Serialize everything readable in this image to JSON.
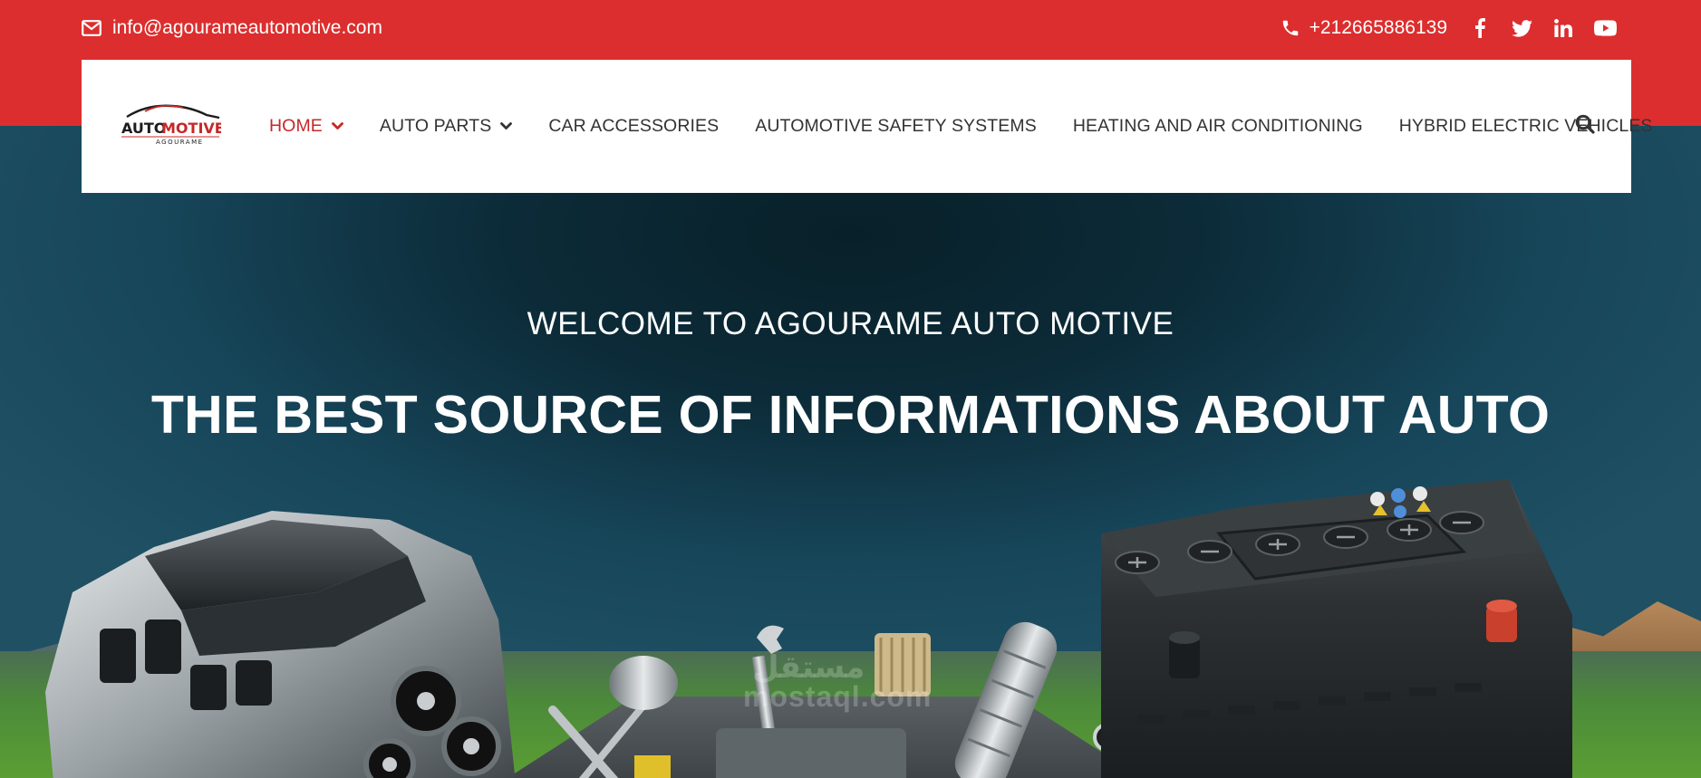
{
  "topbar": {
    "email": "info@agourameautomotive.com",
    "phone": "+212665886139",
    "socials": [
      {
        "icon": "facebook-icon"
      },
      {
        "icon": "twitter-icon"
      },
      {
        "icon": "linkedin-icon"
      },
      {
        "icon": "youtube-icon"
      }
    ],
    "bg_color": "#dc2e2e"
  },
  "logo": {
    "line1a": "AUTO",
    "line1b": "MOTIVE",
    "line2": "AGOURAME"
  },
  "nav": {
    "items": [
      {
        "label": "HOME",
        "dropdown": true,
        "active": true
      },
      {
        "label": "AUTO PARTS",
        "dropdown": true,
        "active": false
      },
      {
        "label": "CAR ACCESSORIES",
        "dropdown": false,
        "active": false
      },
      {
        "label": "AUTOMOTIVE SAFETY SYSTEMS",
        "dropdown": false,
        "active": false
      },
      {
        "label": "HEATING AND AIR CONDITIONING",
        "dropdown": false,
        "active": false
      },
      {
        "label": "HYBRID ELECTRIC VEHICLES",
        "dropdown": false,
        "active": false
      }
    ],
    "active_color": "#c62828"
  },
  "hero": {
    "welcome": "WELCOME TO AGOURAME AUTO MOTIVE",
    "headline": "THE BEST SOURCE OF INFORMATIONS ABOUT AUTO",
    "watermark": "mostaql.com",
    "watermark_ar": "مستقل"
  }
}
